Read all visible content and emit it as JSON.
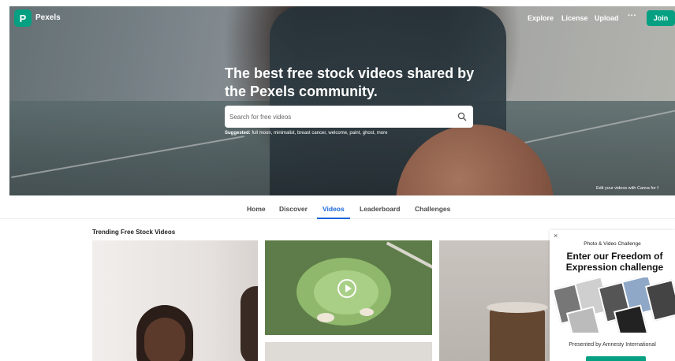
{
  "brand": {
    "name": "Pexels",
    "logo_letter": "P"
  },
  "nav": {
    "explore": "Explore",
    "license": "License",
    "upload": "Upload",
    "more": "···",
    "join": "Join"
  },
  "hero": {
    "headline": "The best free stock videos shared by the Pexels community.",
    "search_placeholder": "Search for free videos",
    "suggested_label": "Suggested:",
    "suggested_terms": "full moon, minimalist, breast cancer, welcome, paint, ghost, more",
    "canva_note": "Edit your videos with Canva for f"
  },
  "tabs": [
    {
      "label": "Home"
    },
    {
      "label": "Discover"
    },
    {
      "label": "Videos"
    },
    {
      "label": "Leaderboard"
    },
    {
      "label": "Challenges"
    }
  ],
  "active_tab": "Videos",
  "section": {
    "title": "Trending Free Stock Videos"
  },
  "popup": {
    "close": "×",
    "kicker": "Photo & Video Challenge",
    "title": "Enter our Freedom of Expression challenge",
    "presented_by": "Presented by Amnesty International"
  },
  "colors": {
    "accent": "#05a081",
    "active_tab": "#1a66d9"
  }
}
